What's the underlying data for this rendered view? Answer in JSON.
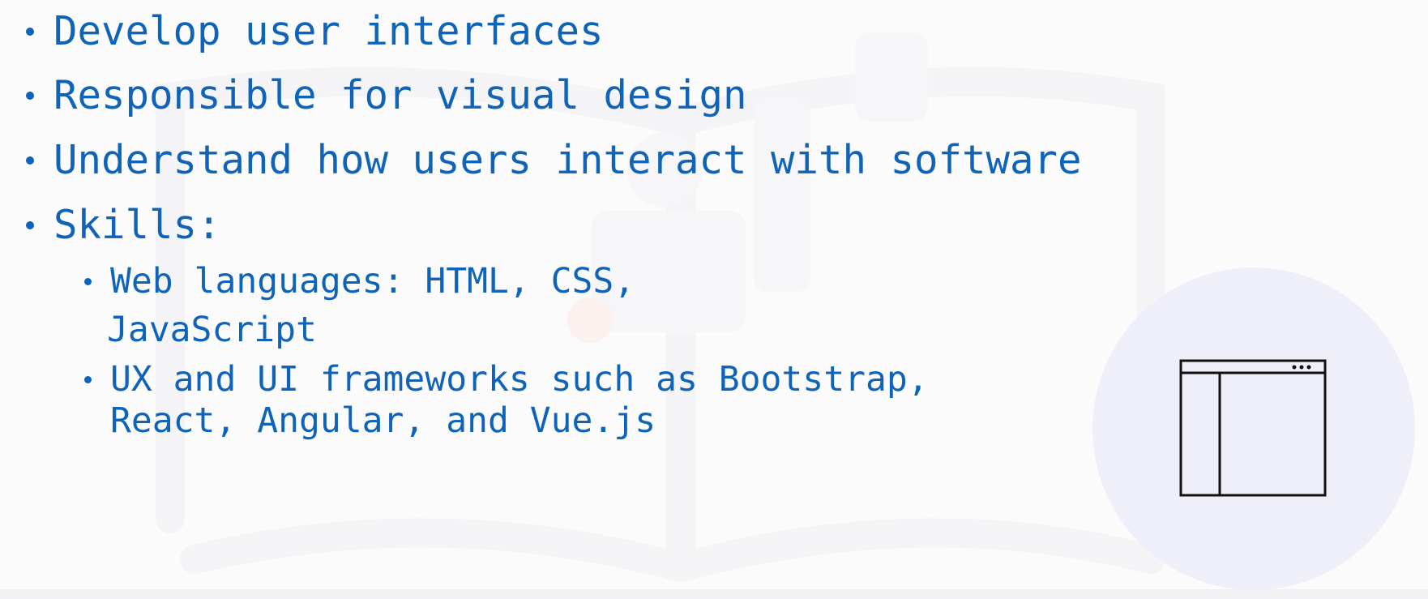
{
  "bullets": [
    {
      "text": "Develop user interfaces"
    },
    {
      "text": "Responsible for visual design"
    },
    {
      "text": "Understand how users interact with software"
    },
    {
      "text": "Skills:"
    }
  ],
  "sub_bullets": [
    {
      "line1": "Web languages: HTML, CSS,",
      "line2": "JavaScript"
    },
    {
      "line1": "UX and UI frameworks such as Bootstrap,",
      "line2": "React, Angular, and Vue.js"
    }
  ],
  "colors": {
    "text": "#0f63b8",
    "circle": "#efeffa",
    "icon_stroke": "#111111"
  },
  "icons": {
    "illustration": "browser-window-icon",
    "bullet": "bullet-dot"
  }
}
